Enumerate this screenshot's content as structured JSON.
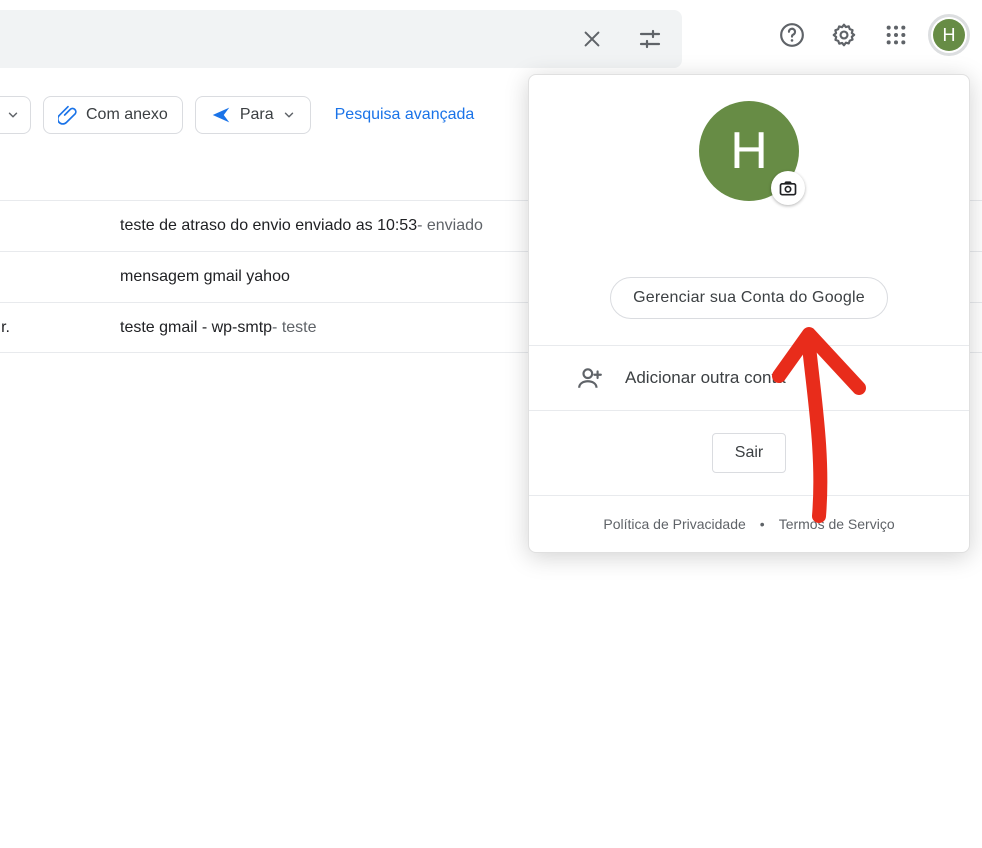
{
  "avatar_initial": "H",
  "search": {
    "clear": "×"
  },
  "filters": {
    "attachment": "Com anexo",
    "to": "Para",
    "advanced": "Pesquisa avançada"
  },
  "rows": [
    {
      "tail": "",
      "subject": "teste de atraso do envio enviado as 10:53",
      "snippet": " - enviado"
    },
    {
      "tail": "",
      "subject": "mensagem gmail yahoo",
      "snippet": ""
    },
    {
      "tail": "r.",
      "subject": "teste gmail - wp-smtp",
      "snippet": " - teste"
    }
  ],
  "menu": {
    "manage": "Gerenciar sua Conta do Google",
    "add": "Adicionar outra conta",
    "signout": "Sair",
    "privacy": "Política de Privacidade",
    "terms": "Termos de Serviço"
  }
}
